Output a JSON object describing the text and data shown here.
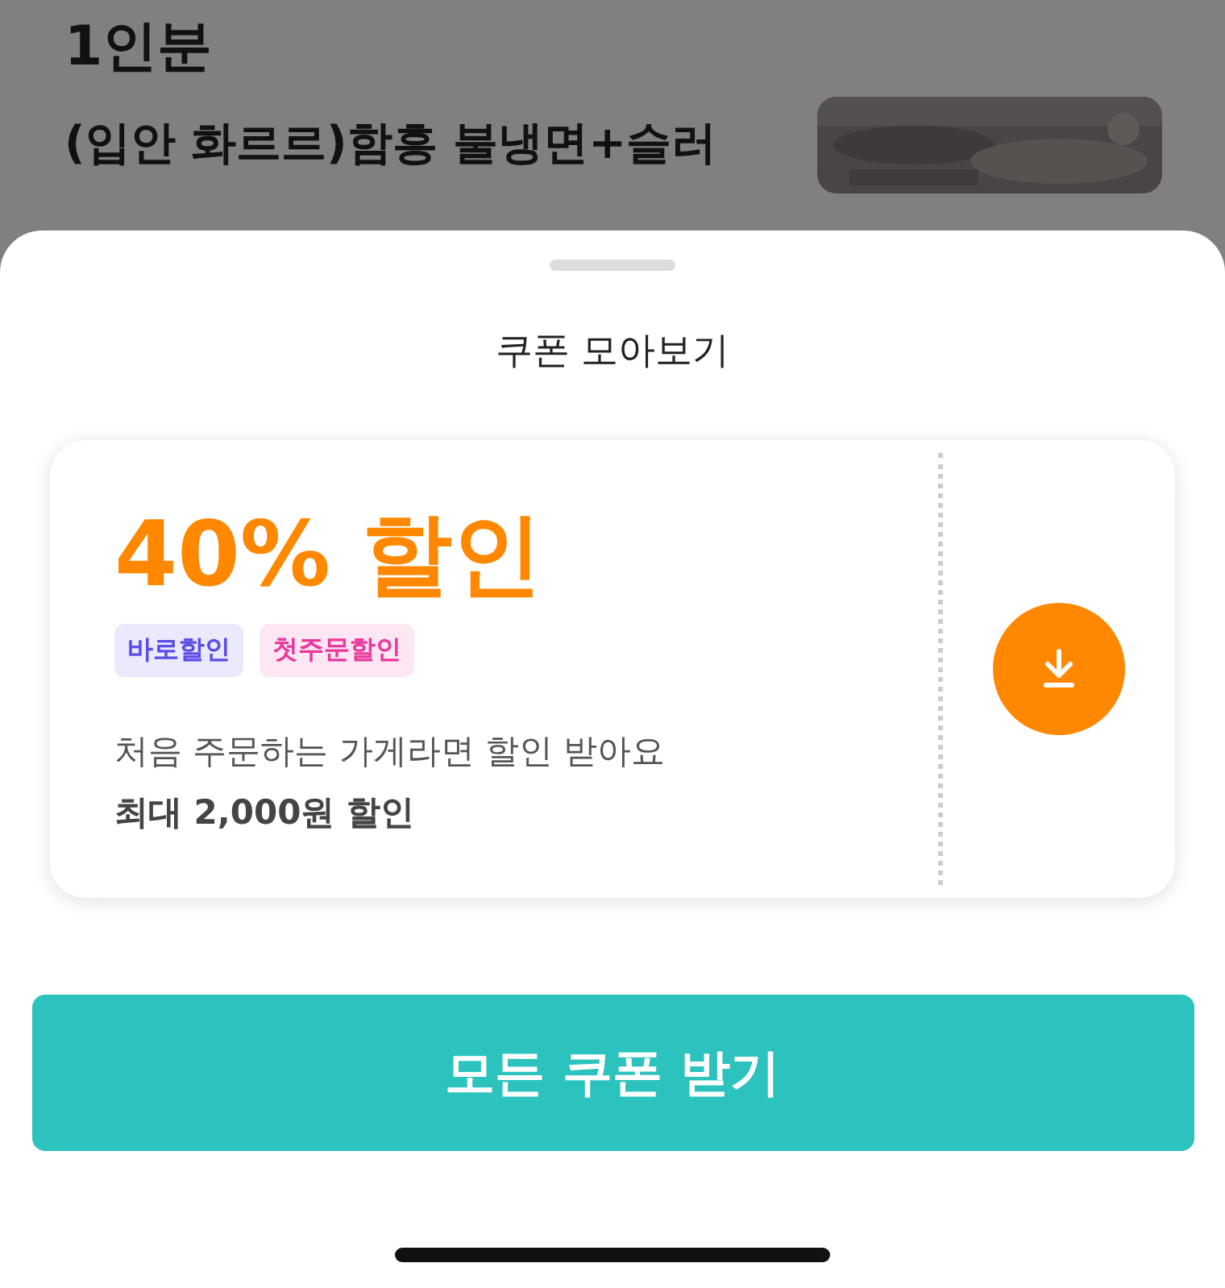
{
  "background": {
    "section_title": "1인분",
    "menu_item": {
      "name": "(입안 화르르)함흥 불냉면+슬러"
    }
  },
  "sheet": {
    "title": "쿠폰 모아보기",
    "coupons": [
      {
        "discount": "40% 할인",
        "tags": [
          {
            "label": "바로할인",
            "color": "#5b4ee6"
          },
          {
            "label": "첫주문할인",
            "color": "#e83a9c"
          }
        ],
        "description": "처음 주문하는 가게라면 할인 받아요",
        "max_discount": "최대 2,000원 할인"
      }
    ],
    "button": "모든 쿠폰 받기"
  }
}
